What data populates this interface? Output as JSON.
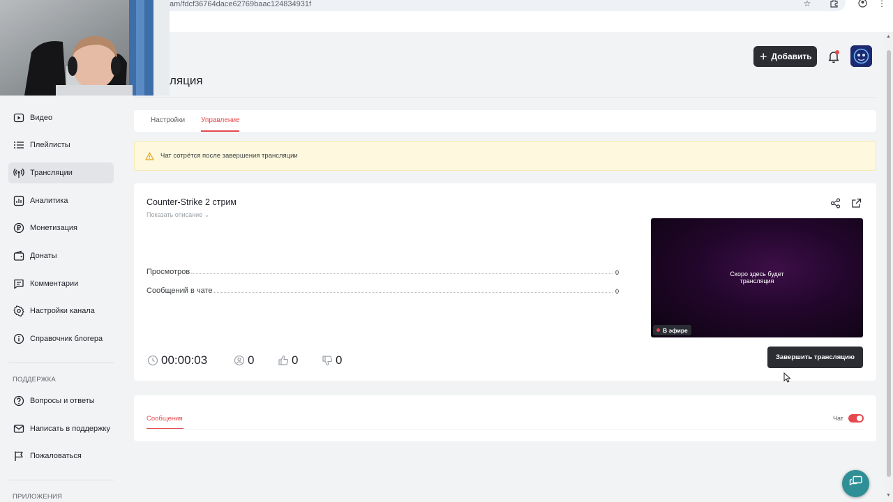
{
  "browser": {
    "url": "am/fdcf36764dace62769baac124834931f"
  },
  "header": {
    "page_title": "ляция",
    "add_label": "Добавить"
  },
  "sidebar": {
    "items": [
      {
        "label": "Видео",
        "icon": "video-icon"
      },
      {
        "label": "Плейлисты",
        "icon": "list-icon"
      },
      {
        "label": "Трансляции",
        "icon": "broadcast-icon",
        "active": true
      },
      {
        "label": "Аналитика",
        "icon": "chart-icon"
      },
      {
        "label": "Монетизация",
        "icon": "ruble-icon"
      },
      {
        "label": "Донаты",
        "icon": "wallet-icon"
      },
      {
        "label": "Комментарии",
        "icon": "comment-icon"
      },
      {
        "label": "Настройки канала",
        "icon": "gear-icon"
      },
      {
        "label": "Справочник блогера",
        "icon": "info-icon"
      }
    ],
    "support_label": "ПОДДЕРЖКА",
    "support_items": [
      {
        "label": "Вопросы и ответы",
        "icon": "question-icon"
      },
      {
        "label": "Написать в поддержку",
        "icon": "mail-icon"
      },
      {
        "label": "Пожаловаться",
        "icon": "flag-icon"
      }
    ],
    "apps_label": "ПРИЛОЖЕНИЯ"
  },
  "tabs": {
    "settings": "Настройки",
    "manage": "Управление",
    "active": "manage"
  },
  "warning": {
    "text": "Чат сотрётся после завершения трансляции"
  },
  "stream": {
    "title": "Counter-Strike 2 стрим",
    "show_description": "Показать описание",
    "stats": [
      {
        "label": "Просмотров",
        "value": "0"
      },
      {
        "label": "Сообщений в чате",
        "value": "0"
      }
    ],
    "preview_line1": "Скоро здесь будет",
    "preview_line2": "трансляция",
    "live_badge": "В эфире",
    "duration": "00:00:03",
    "viewers": "0",
    "likes": "0",
    "dislikes": "0",
    "end_label": "Завершить трансляцию"
  },
  "messages": {
    "tab_label": "Сообщения",
    "chat_label": "Чат",
    "chat_enabled": true
  },
  "colors": {
    "accent": "#e5484d",
    "dark_button": "#2b2d33",
    "warning_bg": "#fdf8de",
    "help_fab": "#2f8f96"
  }
}
